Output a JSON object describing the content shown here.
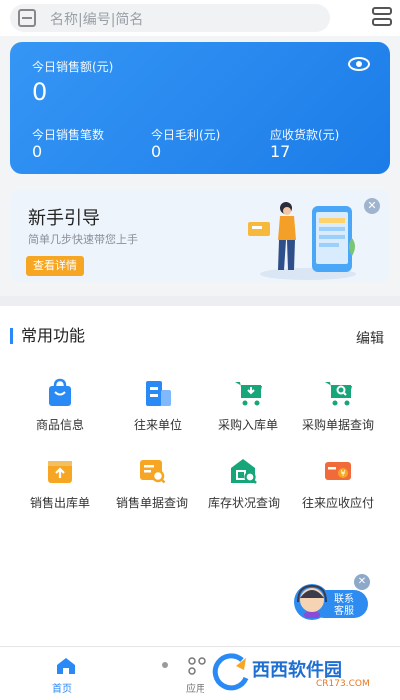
{
  "search": {
    "placeholder": "名称|编号|简名"
  },
  "sales": {
    "today_sales_label": "今日销售额(元)",
    "today_sales_value": "0",
    "today_count_label": "今日销售笔数",
    "today_count_value": "0",
    "today_profit_label": "今日毛利(元)",
    "today_profit_value": "0",
    "receivable_label": "应收货款(元)",
    "receivable_value": "17"
  },
  "guide": {
    "title": "新手引导",
    "subtitle": "简单几步快速带您上手",
    "button": "查看详情",
    "close": "✕"
  },
  "functions": {
    "section_title": "常用功能",
    "edit_label": "编辑",
    "items": [
      {
        "label": "商品信息",
        "icon": "bag-icon",
        "color": "#2a8af5"
      },
      {
        "label": "往来单位",
        "icon": "building-icon",
        "color": "#2a8af5"
      },
      {
        "label": "采购入库单",
        "icon": "cart-in-icon",
        "color": "#17a67a"
      },
      {
        "label": "采购单据查询",
        "icon": "cart-search-icon",
        "color": "#17a67a"
      },
      {
        "label": "销售出库单",
        "icon": "box-out-icon",
        "color": "#f6a623"
      },
      {
        "label": "销售单据查询",
        "icon": "doc-search-icon",
        "color": "#f6a623"
      },
      {
        "label": "库存状况查询",
        "icon": "warehouse-search-icon",
        "color": "#17a67a"
      },
      {
        "label": "往来应收应付",
        "icon": "money-icon",
        "color": "#f06a3a"
      }
    ]
  },
  "nav": {
    "home_label": "首页",
    "apps_label": "应用"
  },
  "service": {
    "label_line1": "联系",
    "label_line2": "客服",
    "close": "✕"
  },
  "watermark": {
    "brand": "西西软件园",
    "url": "CR173.COM"
  }
}
